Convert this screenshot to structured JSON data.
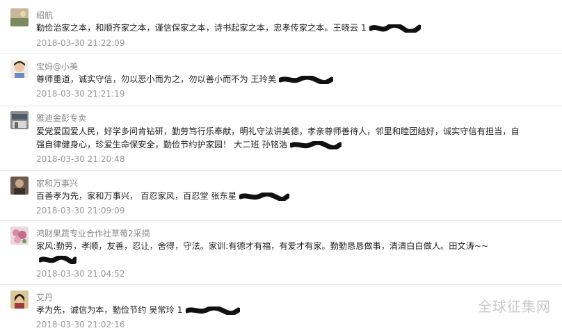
{
  "comments": [
    {
      "user": "绍航",
      "text": "勤俭治家之本，和顺齐家之本，谨信保家之本，诗书起家之本，忠孝传家之本。王晓云 1",
      "time": "2018-03-30 21:22:09",
      "avatar": "avatar-landscape"
    },
    {
      "user": "宝妈@小美",
      "text": "尊师重道，诚实守信，勿以恶小而为之，勿以善小而不为 王玲美",
      "time": "2018-03-30 21:21:19",
      "avatar": "avatar-child-photo"
    },
    {
      "user": "雅迪金彭专卖",
      "text": "爱党爱国爱人民，好学多问肯钻研，勤劳笃行乐奉献，明礼守法讲美德，孝亲尊师善待人，邻里和睦团结好，诚实守信有担当，自强自律健身心，珍爱生命保安全，勤俭节约护家园！ 大二班 孙铭浩",
      "time": "2018-03-30 21:20:48",
      "avatar": "avatar-storefront"
    },
    {
      "user": "家和万事兴",
      "text": "百善孝为先，家和万事兴， 百忍家风，百忍堂 张东星",
      "time": "2018-03-30 21:09:09",
      "avatar": "avatar-portrait"
    },
    {
      "user": "鸿财果蔬专业合作社草莓2采摘",
      "text": "家风:勤劳，孝顺，友善，忍让，舍得，守法。家训:有德才有福，有爱才有家。勤勤恳恳做事，清清白白做人。田文涛~~",
      "time": "2018-03-30 21:04:52",
      "avatar": "avatar-flowers"
    },
    {
      "user": "艾丹",
      "text": "孝为先，诚信为本，勤俭节约 吴常玲 1",
      "time": "2018-03-30 21:02:16",
      "avatar": "avatar-girl-photo"
    }
  ],
  "watermark": "全球征集网",
  "colors": {
    "username": "#8a8a8a",
    "text": "#222222",
    "timestamp": "#999999",
    "divider": "#e6e6e6",
    "redaction": "#111111"
  }
}
